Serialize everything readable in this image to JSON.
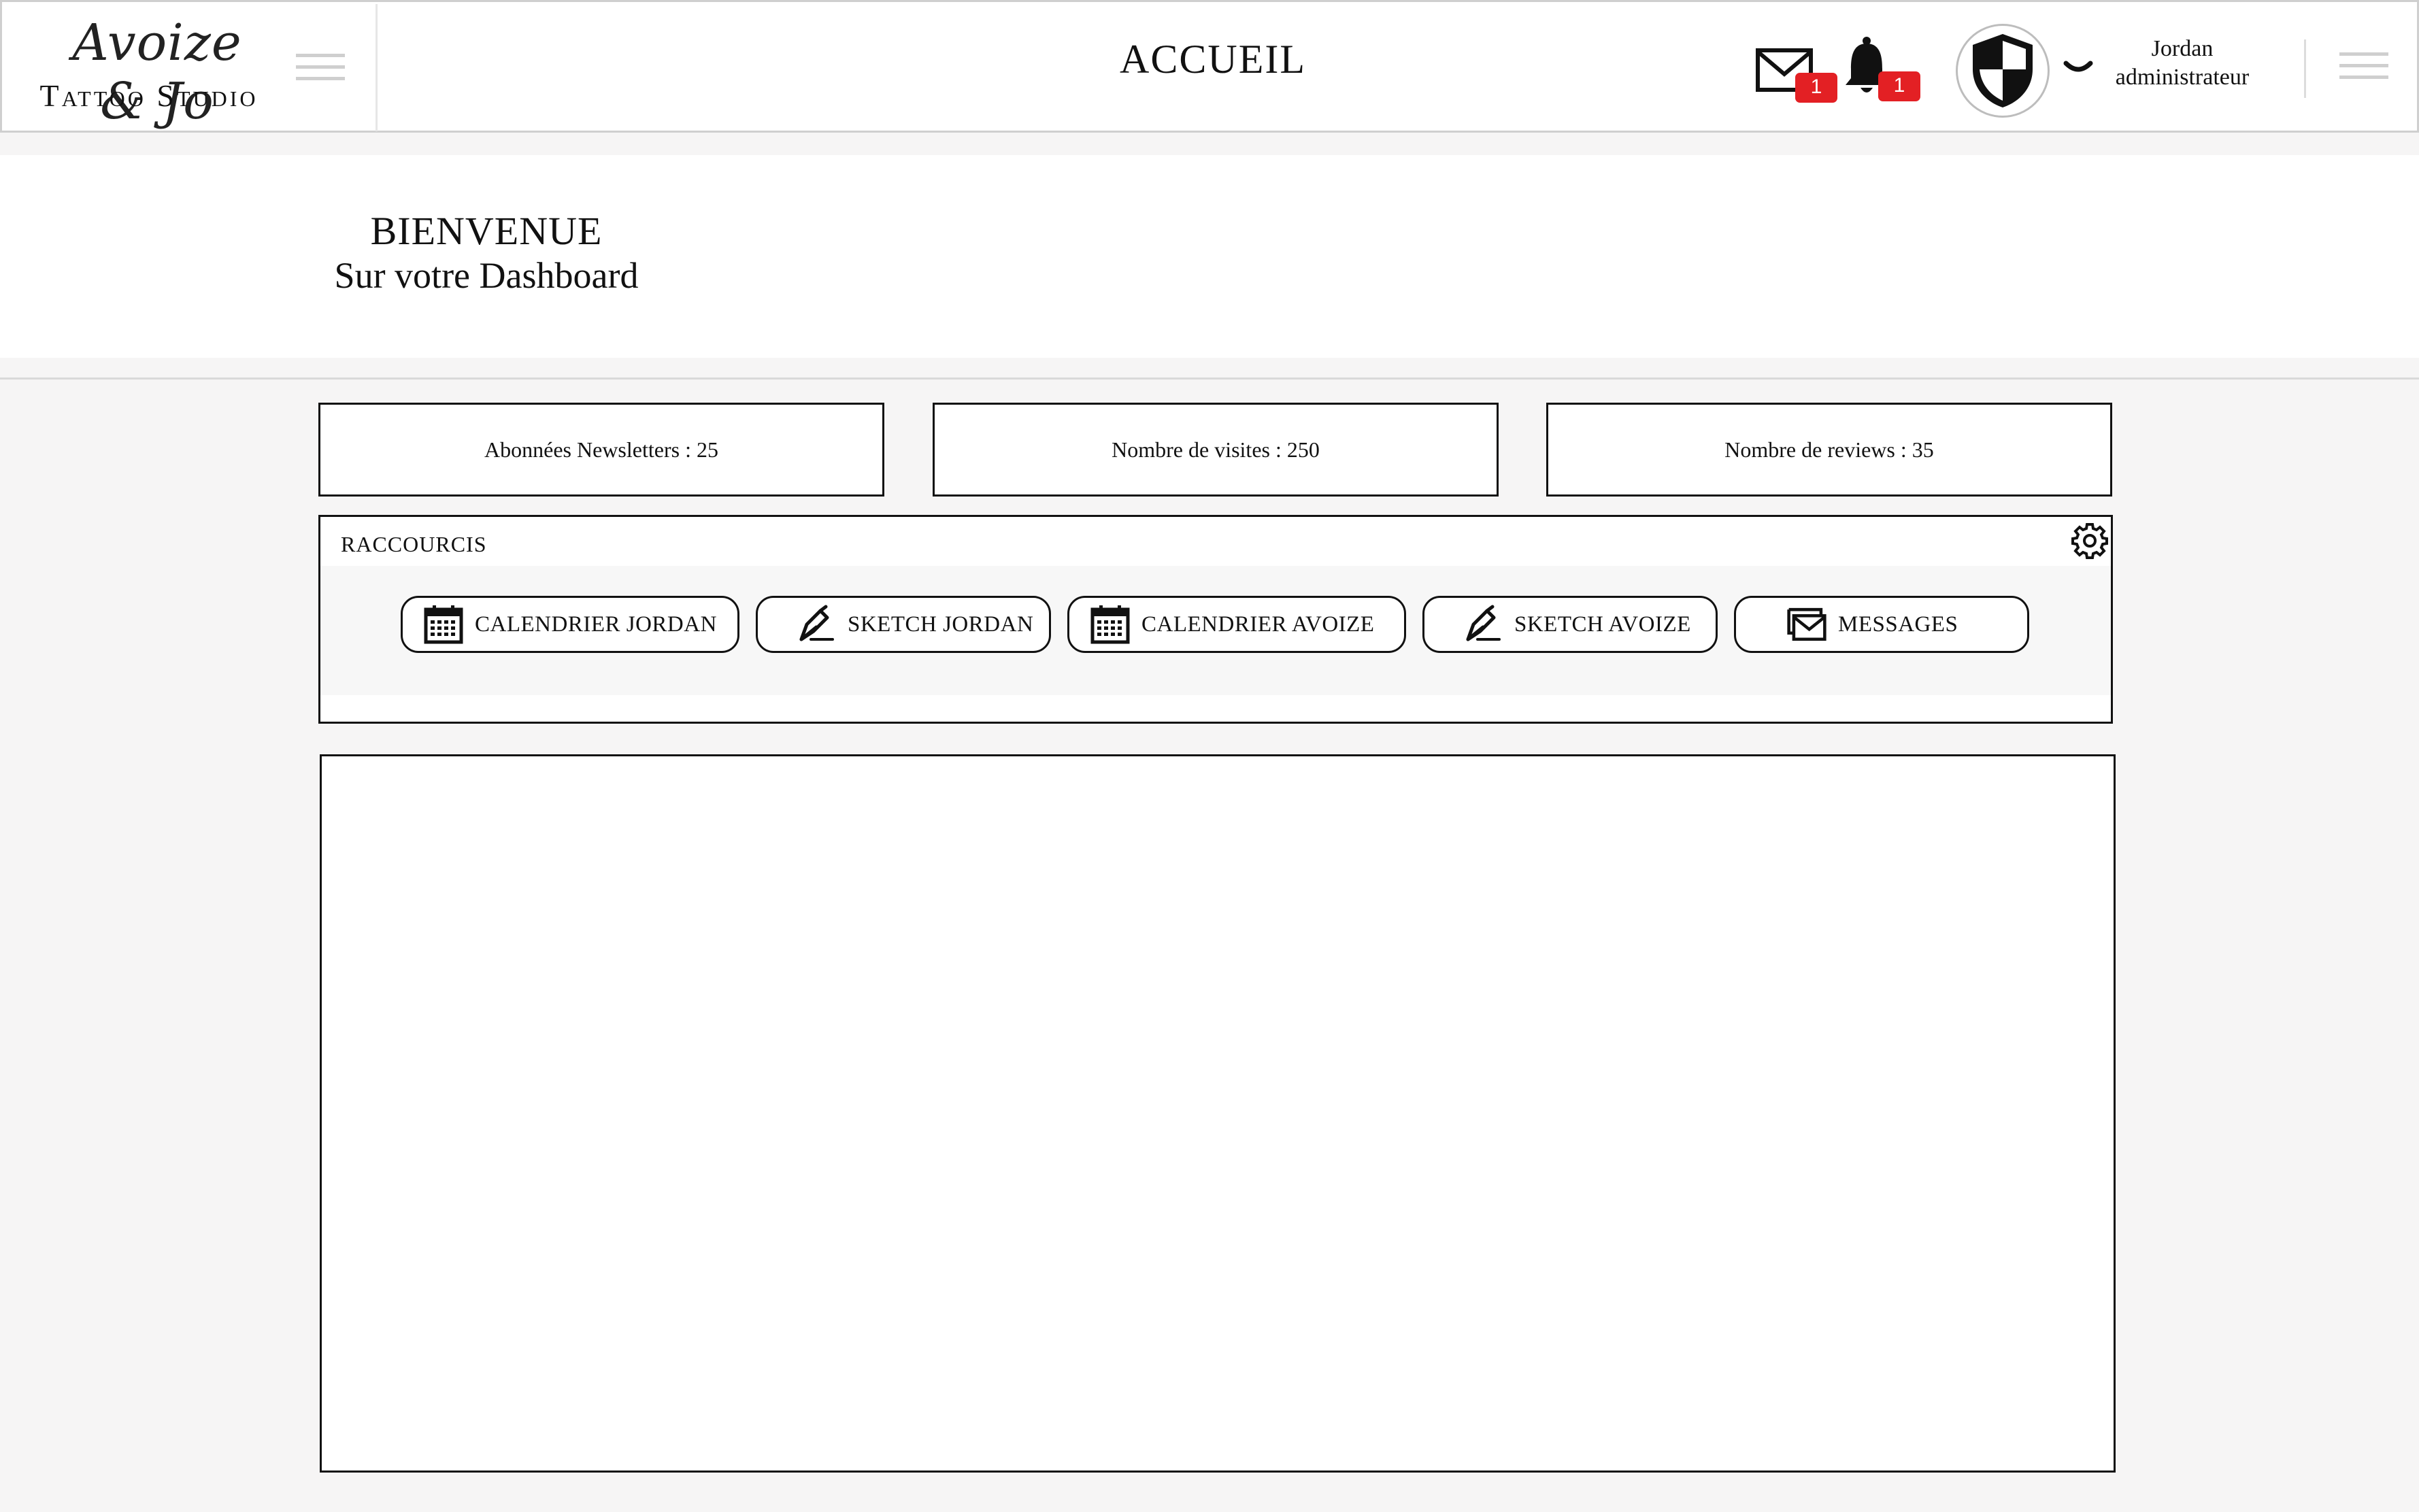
{
  "brand": {
    "script_name": "Avoize & Jo",
    "studio_name": "Tattoo Studio"
  },
  "header": {
    "title": "ACCUEIL",
    "messages_badge": "1",
    "notifications_badge": "1",
    "user_name": "Jordan",
    "user_role": "administrateur"
  },
  "welcome": {
    "title": "BIENVENUE",
    "subtitle": "Sur votre Dashboard"
  },
  "stats": [
    {
      "label": "Abonnées Newsletters : 25"
    },
    {
      "label": "Nombre de visites : 250"
    },
    {
      "label": "Nombre de reviews : 35"
    }
  ],
  "shortcuts": {
    "title": "RACCOURCIS",
    "items": [
      {
        "label": "CALENDRIER JORDAN",
        "icon": "calendar-icon"
      },
      {
        "label": "SKETCH JORDAN",
        "icon": "pen-icon"
      },
      {
        "label": "CALENDRIER AVOIZE",
        "icon": "calendar-icon"
      },
      {
        "label": "SKETCH AVOIZE",
        "icon": "pen-icon"
      },
      {
        "label": "MESSAGES",
        "icon": "messages-icon"
      }
    ]
  },
  "colors": {
    "badge": "#e32024",
    "border": "#111111",
    "background": "#f6f5f5"
  }
}
